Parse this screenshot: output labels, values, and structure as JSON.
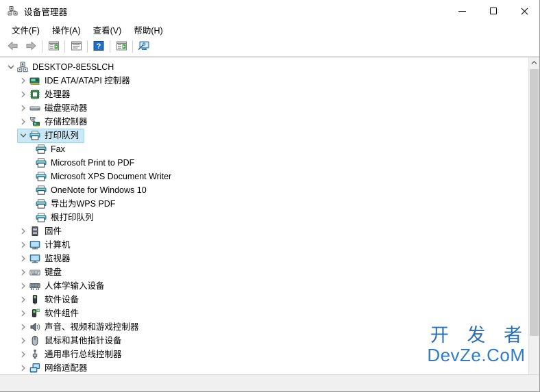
{
  "window": {
    "title": "设备管理器",
    "icon": "device-manager-icon",
    "controls": {
      "minimize": "最小化",
      "maximize": "最大化",
      "close": "关闭"
    }
  },
  "menubar": {
    "items": [
      {
        "label": "文件(F)",
        "name": "menu-file"
      },
      {
        "label": "操作(A)",
        "name": "menu-action"
      },
      {
        "label": "查看(V)",
        "name": "menu-view"
      },
      {
        "label": "帮助(H)",
        "name": "menu-help"
      }
    ]
  },
  "toolbar": {
    "items": [
      {
        "name": "back-icon",
        "title": "后退"
      },
      {
        "name": "forward-icon",
        "title": "前进"
      },
      {
        "name": "show-hide-console-tree-icon",
        "title": "显示/隐藏控制台树"
      },
      {
        "name": "properties-icon",
        "title": "属性"
      },
      {
        "name": "help-icon",
        "title": "帮助"
      },
      {
        "name": "update-driver-icon",
        "title": "更新驱动程序"
      },
      {
        "name": "scan-hardware-changes-icon",
        "title": "扫描检测硬件改动"
      }
    ]
  },
  "tree": {
    "root": {
      "label": "DESKTOP-8E5SLCH",
      "icon": "computer-icon",
      "expanded": true,
      "selected": false
    },
    "nodes": [
      {
        "label": "IDE ATA/ATAPI 控制器",
        "icon": "ide-controller-icon",
        "expanded": false,
        "selected": false,
        "level": 1
      },
      {
        "label": "处理器",
        "icon": "processor-icon",
        "expanded": false,
        "selected": false,
        "level": 1
      },
      {
        "label": "磁盘驱动器",
        "icon": "disk-drive-icon",
        "expanded": false,
        "selected": false,
        "level": 1
      },
      {
        "label": "存储控制器",
        "icon": "storage-controller-icon",
        "expanded": false,
        "selected": false,
        "level": 1
      },
      {
        "label": "打印队列",
        "icon": "printer-icon",
        "expanded": true,
        "selected": true,
        "level": 1
      },
      {
        "label": "Fax",
        "icon": "printer-icon",
        "leaf": true,
        "selected": false,
        "level": 2
      },
      {
        "label": "Microsoft Print to PDF",
        "icon": "printer-icon",
        "leaf": true,
        "selected": false,
        "level": 2
      },
      {
        "label": "Microsoft XPS Document Writer",
        "icon": "printer-icon",
        "leaf": true,
        "selected": false,
        "level": 2
      },
      {
        "label": "OneNote for Windows 10",
        "icon": "printer-icon",
        "leaf": true,
        "selected": false,
        "level": 2
      },
      {
        "label": "导出为WPS PDF",
        "icon": "printer-icon",
        "leaf": true,
        "selected": false,
        "level": 2
      },
      {
        "label": "根打印队列",
        "icon": "printer-icon",
        "leaf": true,
        "selected": false,
        "level": 2
      },
      {
        "label": "固件",
        "icon": "firmware-icon",
        "expanded": false,
        "selected": false,
        "level": 1
      },
      {
        "label": "计算机",
        "icon": "monitor-icon",
        "expanded": false,
        "selected": false,
        "level": 1
      },
      {
        "label": "监视器",
        "icon": "monitor-icon",
        "expanded": false,
        "selected": false,
        "level": 1
      },
      {
        "label": "键盘",
        "icon": "keyboard-icon",
        "expanded": false,
        "selected": false,
        "level": 1
      },
      {
        "label": "人体学输入设备",
        "icon": "hid-icon",
        "expanded": false,
        "selected": false,
        "level": 1
      },
      {
        "label": "软件设备",
        "icon": "software-device-icon",
        "expanded": false,
        "selected": false,
        "level": 1
      },
      {
        "label": "软件组件",
        "icon": "software-component-icon",
        "expanded": false,
        "selected": false,
        "level": 1
      },
      {
        "label": "声音、视频和游戏控制器",
        "icon": "speaker-icon",
        "expanded": false,
        "selected": false,
        "level": 1
      },
      {
        "label": "鼠标和其他指针设备",
        "icon": "mouse-icon",
        "expanded": false,
        "selected": false,
        "level": 1
      },
      {
        "label": "通用串行总线控制器",
        "icon": "usb-icon",
        "expanded": false,
        "selected": false,
        "level": 1
      },
      {
        "label": "网络适配器",
        "icon": "network-adapter-icon",
        "expanded": false,
        "selected": false,
        "level": 1
      }
    ]
  },
  "scrollbar": {
    "up_arrow": "向上滚动",
    "position": "top"
  },
  "statusbar": {
    "text": ""
  },
  "watermark": {
    "line1": "开 发 者",
    "line2": "DevZe.CoM",
    "color": "#2c6fb5"
  },
  "colors": {
    "selection_bg": "#cbe8f6",
    "selection_border": "#a6d3e8",
    "window_bg": "#ffffff",
    "statusbar_bg": "#f0f0f0",
    "scrollbar_thumb": "#cdcdcd"
  }
}
